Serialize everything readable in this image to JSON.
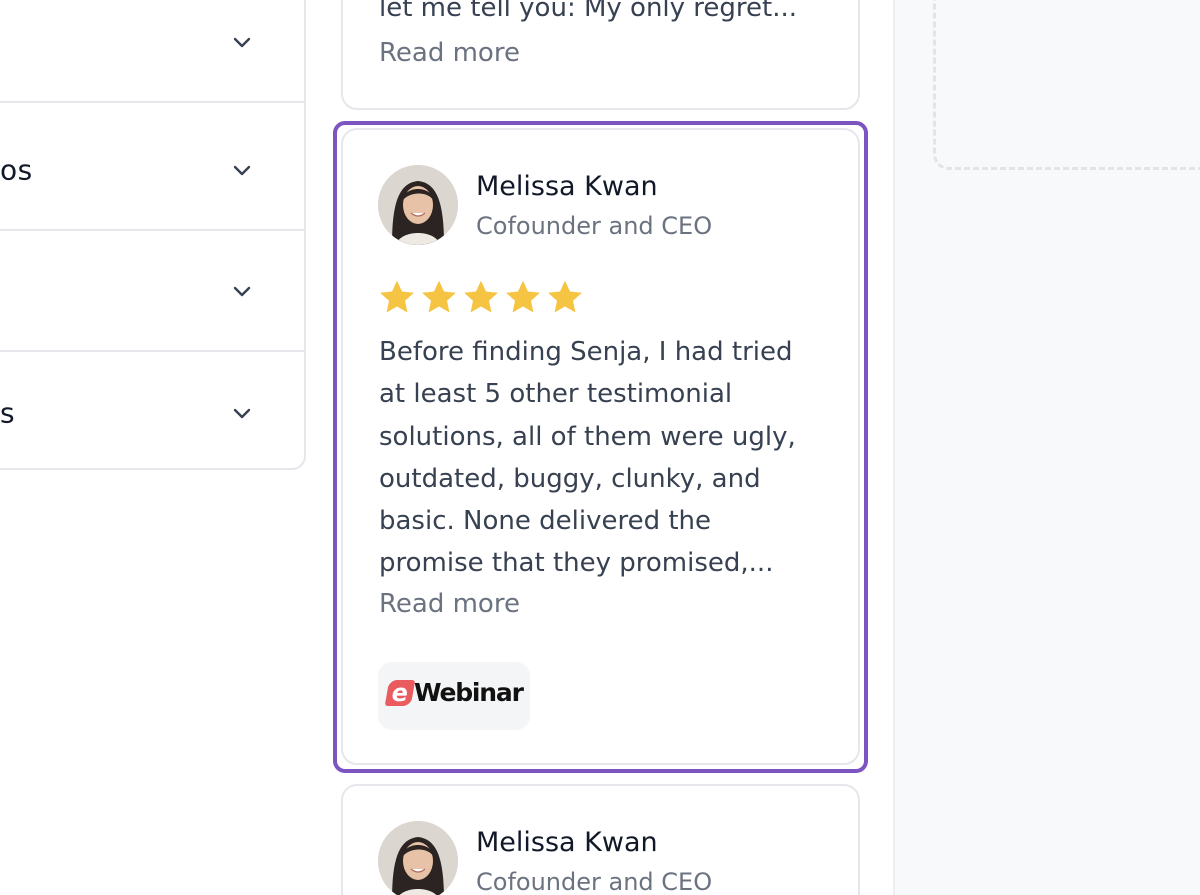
{
  "accordion": {
    "items": [
      {
        "label": "",
        "icon": "chevron-down-icon"
      },
      {
        "label": "os",
        "icon": "chevron-down-icon"
      },
      {
        "label": "",
        "icon": "chevron-down-icon"
      },
      {
        "label": "s",
        "icon": "chevron-down-icon"
      }
    ]
  },
  "cards": {
    "top": {
      "text": "let me tell you: My only regret...",
      "read_more": "Read more"
    },
    "main": {
      "author_name": "Melissa Kwan",
      "author_title": "Cofounder and CEO",
      "rating": 5,
      "body_lines": [
        "Before finding Senja, I had tried",
        "at least 5 other testimonial",
        "solutions, all of them were ugly,",
        "outdated, buggy, clunky, and",
        "basic. None delivered the",
        "promise that they promised,..."
      ],
      "read_more": "Read more",
      "company_logo": {
        "mark": "e",
        "text": "Webinar"
      }
    },
    "bottom": {
      "author_name": "Melissa Kwan",
      "author_title": "Cofounder and CEO"
    }
  },
  "colors": {
    "highlight": "#7c55c2",
    "star": "#f6c443",
    "logo_accent": "#ea5b5f",
    "right_area_bg": "#f8f9fb"
  }
}
